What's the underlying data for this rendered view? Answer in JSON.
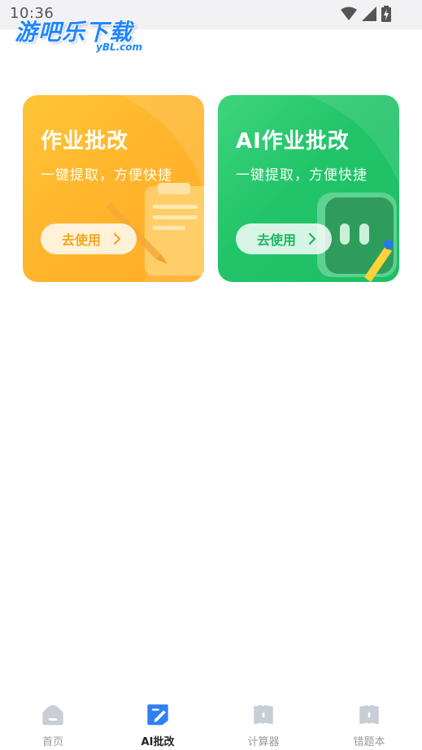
{
  "status_bar": {
    "time": "10:36"
  },
  "logo": {
    "main": "游吧乐下载",
    "sub": "yBL.com"
  },
  "cards": [
    {
      "title": "作业批改",
      "subtitle": "一键提取，方便快捷",
      "button": "去使用"
    },
    {
      "title": "AI作业批改",
      "subtitle": "一键提取，方便快捷",
      "button": "去使用"
    }
  ],
  "nav": [
    {
      "label": "首页",
      "icon": "home-icon",
      "active": false
    },
    {
      "label": "AI批改",
      "icon": "ai-correct-icon",
      "active": true
    },
    {
      "label": "计算器",
      "icon": "calculator-icon",
      "active": false
    },
    {
      "label": "错题本",
      "icon": "mistake-book-icon",
      "active": false
    }
  ],
  "colors": {
    "card_yellow": "#ffb62c",
    "card_green": "#22c46a",
    "nav_active": "#2f80f6",
    "nav_inactive": "#c8ced6"
  }
}
